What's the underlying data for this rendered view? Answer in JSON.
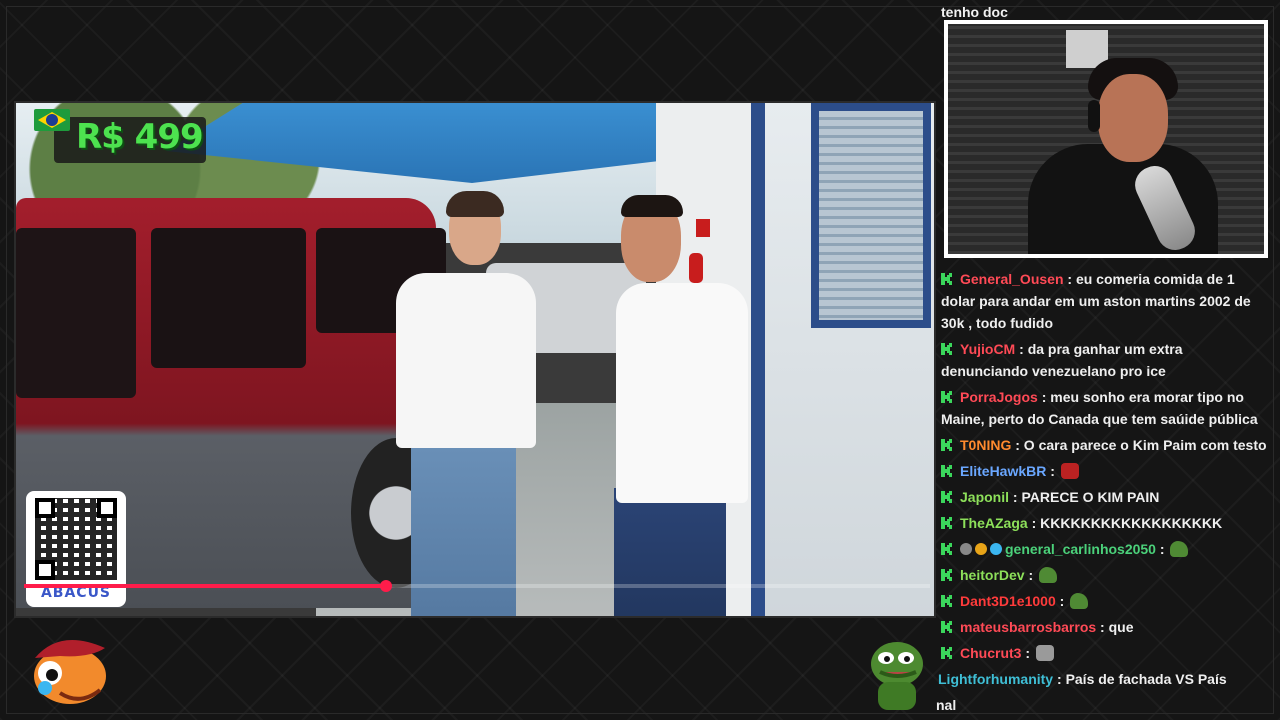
{
  "video": {
    "price_overlay": "R$ 499",
    "qr_label": "ABACUS",
    "progress_fraction": 0.4,
    "progress_color": "#ff1c4a"
  },
  "chat": {
    "partial_top": "tenho doc",
    "messages": [
      {
        "user": "General_Ousen",
        "color": "#ff4a56",
        "text": "eu comeria comida de 1 dolar para andar em um aston martins 2002 de 30k , todo fudido",
        "emote": null
      },
      {
        "user": "YujioCM",
        "color": "#ff4a56",
        "text": "da pra ganhar um extra denunciando venezuelano pro ice",
        "emote": null
      },
      {
        "user": "PorraJogos",
        "color": "#ff4a56",
        "text": "meu sonho era morar tipo no Maine, perto do Canada que tem saúide pública",
        "emote": null
      },
      {
        "user": "T0NING",
        "color": "#ff8a2e",
        "text": "O cara parece o Kim Paim com testo",
        "emote": null
      },
      {
        "user": "EliteHawkBR",
        "color": "#6aa7ff",
        "text": "",
        "emote": "red-face-emote"
      },
      {
        "user": "Japonil",
        "color": "#8de05a",
        "text": "PARECE O KIM PAIN",
        "emote": null
      },
      {
        "user": "TheAZaga",
        "color": "#8de05a",
        "text": "KKKKKKKKKKKKKKKKKK",
        "emote": null
      },
      {
        "user": "general_carlinhos2050",
        "color": "#4bd17a",
        "text": "",
        "emote": "pepe-emote"
      },
      {
        "user": "heitorDev",
        "color": "#8de05a",
        "text": "",
        "emote": "pepe-emote"
      },
      {
        "user": "Dant3D1e1000",
        "color": "#ff3b3b",
        "text": "",
        "emote": "pepe-emote"
      },
      {
        "user": "mateusbarrosbarros",
        "color": "#ff4a56",
        "text": "que",
        "emote": null
      },
      {
        "user": "Chucrut3",
        "color": "#ff4a56",
        "text": "",
        "emote": "cat-emote"
      },
      {
        "user": "Lightforhumanity",
        "color": "#3fbfd6",
        "text": "País de fachada VS País",
        "emote": null
      }
    ],
    "partial_bottom": "nal"
  },
  "colors": {
    "badge_green": "#3bd75c",
    "background": "#151515"
  }
}
